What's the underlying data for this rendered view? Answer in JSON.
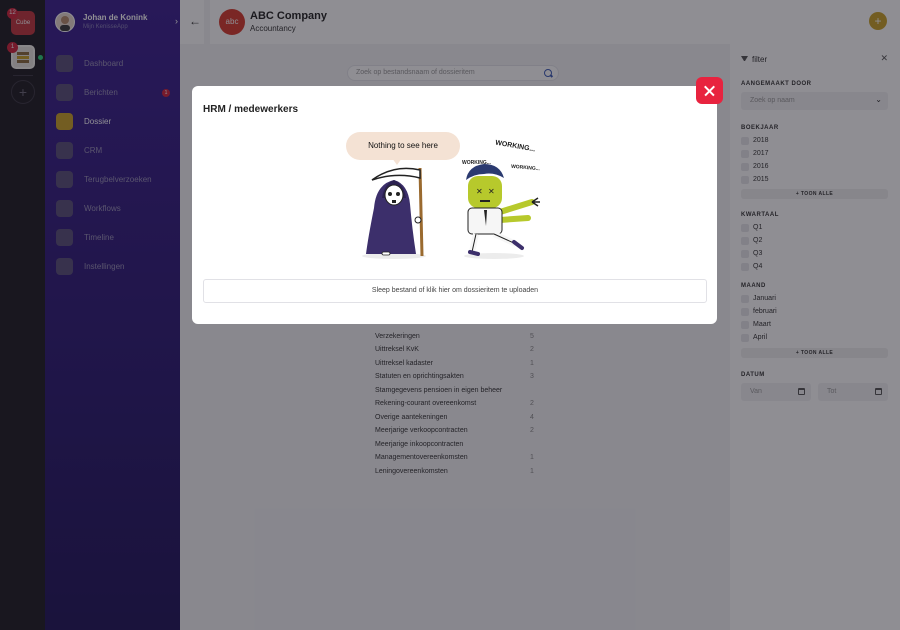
{
  "rail": {
    "apps": [
      {
        "name": "Cube",
        "badge": "12"
      },
      {
        "name": "",
        "badge": "1"
      }
    ],
    "add_label": "+"
  },
  "nav": {
    "user_name": "Johan de Konink",
    "user_sub": "Mijn KenisseApp",
    "items": [
      {
        "label": "Dashboard",
        "icon": "dashboard-icon",
        "active": false
      },
      {
        "label": "Berichten",
        "icon": "messages-icon",
        "active": false,
        "badge": "1"
      },
      {
        "label": "Dossier",
        "icon": "folder-icon",
        "active": true
      },
      {
        "label": "CRM",
        "icon": "crm-icon",
        "active": false
      },
      {
        "label": "Terugbelverzoeken",
        "icon": "phone-icon",
        "active": false
      },
      {
        "label": "Workflows",
        "icon": "workflow-icon",
        "active": false
      },
      {
        "label": "Timeline",
        "icon": "timeline-icon",
        "active": false
      },
      {
        "label": "Instellingen",
        "icon": "settings-icon",
        "active": false
      }
    ]
  },
  "header": {
    "company_name": "ABC Company",
    "company_sub": "Accountancy",
    "logo_text": "abc",
    "add_label": "+"
  },
  "content": {
    "search_placeholder": "Zoek op bestandsnaam of dossieritem",
    "items": [
      {
        "name": "Verzekeringen",
        "count": "5"
      },
      {
        "name": "Uittreksel KvK",
        "count": "2"
      },
      {
        "name": "Uittreksel kadaster",
        "count": "1"
      },
      {
        "name": "Statuten en oprichtingsakten",
        "count": "3"
      },
      {
        "name": "Stamgegevens pensioen in eigen beheer",
        "count": ""
      },
      {
        "name": "Rekening-courant overeenkomst",
        "count": "2"
      },
      {
        "name": "Overige aantekeningen",
        "count": "4"
      },
      {
        "name": "Meerjarige verkoopcontracten",
        "count": "2"
      },
      {
        "name": "Meerjarige inkoopcontracten",
        "count": ""
      },
      {
        "name": "Managementovereenkomsten",
        "count": "1"
      },
      {
        "name": "Leningovereenkomsten",
        "count": "1"
      }
    ]
  },
  "filter": {
    "title": "filter",
    "created_by_label": "AANGEMAAKT DOOR",
    "created_by_placeholder": "Zoek op naam",
    "year_label": "BOEKJAAR",
    "years": [
      "2018",
      "2017",
      "2016",
      "2015"
    ],
    "quarter_label": "KWARTAAL",
    "quarters": [
      "Q1",
      "Q2",
      "Q3",
      "Q4"
    ],
    "month_label": "MAAND",
    "months": [
      "Januari",
      "februari",
      "Maart",
      "April"
    ],
    "show_all_label": "+ TOON ALLE",
    "date_label": "DATUM",
    "date_from_placeholder": "Van",
    "date_to_placeholder": "Tot"
  },
  "modal": {
    "title": "HRM / medewerkers",
    "bubble_text": "Nothing to see here",
    "working_big": "WORKING...",
    "working_small": "WORKING...",
    "working_small_2": "WORKING...",
    "upload_text": "Sleep bestand of klik hier om dossieritem te uploaden",
    "accent_color": "#e8233f"
  }
}
